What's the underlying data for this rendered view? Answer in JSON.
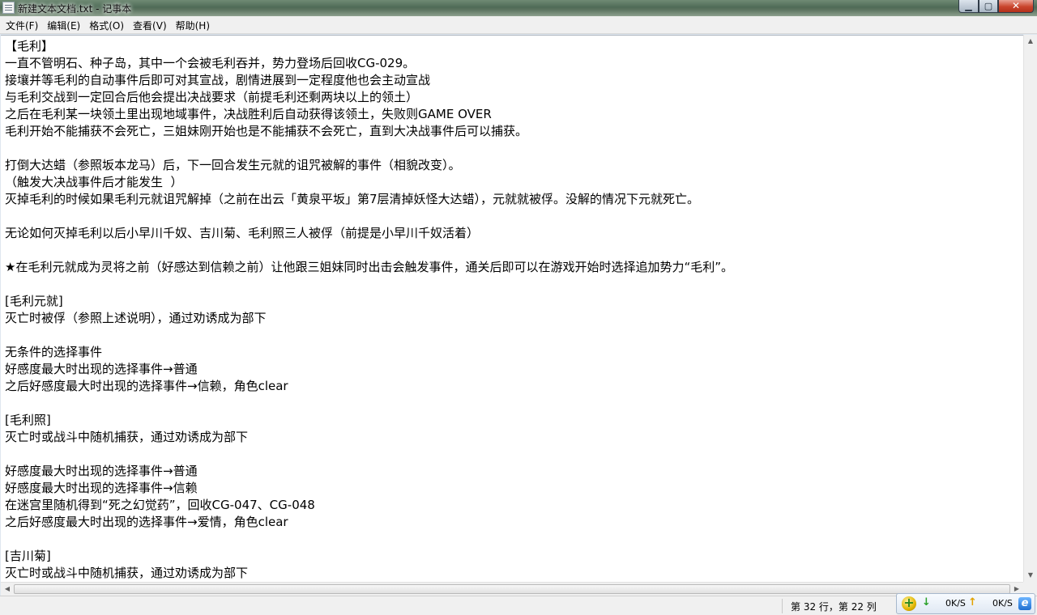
{
  "window": {
    "title": "新建文本文档.txt - 记事本"
  },
  "caption_buttons": {
    "minimize": "▁",
    "maximize": "▢",
    "close": "✕"
  },
  "menu": [
    {
      "label": "文件(F)"
    },
    {
      "label": "编辑(E)"
    },
    {
      "label": "格式(O)"
    },
    {
      "label": "查看(V)"
    },
    {
      "label": "帮助(H)"
    }
  ],
  "document": {
    "lines": [
      "【毛利】",
      "一直不管明石、种子岛，其中一个会被毛利吞并，势力登场后回收CG-029。",
      "接壤并等毛利的自动事件后即可对其宣战，剧情进展到一定程度他也会主动宣战",
      "与毛利交战到一定回合后他会提出决战要求（前提毛利还剩两块以上的领土）",
      "之后在毛利某一块领土里出现地域事件，决战胜利后自动获得该领土，失败则GAME OVER",
      "毛利开始不能捕获不会死亡，三姐妹刚开始也是不能捕获不会死亡，直到大决战事件后可以捕获。",
      "",
      "打倒大达蜡（参照坂本龙马）后，下一回合发生元就的诅咒被解的事件（相貌改变）。",
      "（触发大决战事件后才能发生  ）",
      "灭掉毛利的时候如果毛利元就诅咒解掉（之前在出云「黄泉平坂」第7层清掉妖怪大达蜡），元就就被俘。没解的情况下元就死亡。",
      "",
      "无论如何灭掉毛利以后小早川千奴、吉川菊、毛利照三人被俘（前提是小早川千奴活着）",
      "",
      "★在毛利元就成为灵将之前（好感达到信赖之前）让他跟三姐妹同时出击会触发事件，通关后即可以在游戏开始时选择追加势力“毛利”。",
      "",
      "[毛利元就]",
      "灭亡时被俘（参照上述说明），通过劝诱成为部下",
      "",
      "无条件的选择事件",
      "好感度最大时出现的选择事件→普通",
      "之后好感度最大时出现的选择事件→信赖，角色clear",
      "",
      "[毛利照]",
      "灭亡时或战斗中随机捕获，通过劝诱成为部下",
      "",
      "好感度最大时出现的选择事件→普通",
      "好感度最大时出现的选择事件→信赖",
      "在迷宫里随机得到“死之幻觉药”，回收CG-047、CG-048",
      "之后好感度最大时出现的选择事件→爱情，角色clear",
      "",
      "[吉川菊]",
      "灭亡时或战斗中随机捕获，通过劝诱成为部下"
    ]
  },
  "status": {
    "position": "第 32 行，第 22 列"
  },
  "net_widget": {
    "down_speed": "0K/S",
    "up_speed": "0K/S",
    "down_icon": "down-arrow-icon",
    "up_icon": "up-arrow-icon",
    "browser_glyph": "e"
  }
}
